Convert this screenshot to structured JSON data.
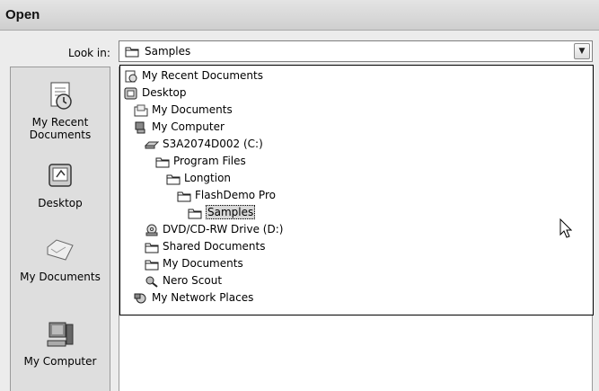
{
  "dialog": {
    "title": "Open"
  },
  "look_in": {
    "label": "Look in:",
    "value": "Samples",
    "dropdown_icon": "chevron-down-icon"
  },
  "places": [
    {
      "label": "My Recent Documents",
      "icon": "recent-documents-icon"
    },
    {
      "label": "Desktop",
      "icon": "desktop-icon"
    },
    {
      "label": "My Documents",
      "icon": "my-documents-icon"
    },
    {
      "label": "My Computer",
      "icon": "my-computer-icon"
    }
  ],
  "dropdown_items": [
    {
      "label": "My Recent Documents",
      "icon": "recent-documents-icon",
      "level": 0
    },
    {
      "label": "Desktop",
      "icon": "desktop-icon",
      "level": 0
    },
    {
      "label": "My Documents",
      "icon": "my-documents-icon",
      "level": 1
    },
    {
      "label": "My Computer",
      "icon": "my-computer-icon",
      "level": 1
    },
    {
      "label": "S3A2074D002 (C:)",
      "icon": "hard-drive-icon",
      "level": 2
    },
    {
      "label": "Program Files",
      "icon": "folder-icon",
      "level": 3
    },
    {
      "label": "Longtion",
      "icon": "folder-icon",
      "level": 4
    },
    {
      "label": "FlashDemo Pro",
      "icon": "folder-icon",
      "level": 5
    },
    {
      "label": "Samples",
      "icon": "folder-icon",
      "level": 6,
      "selected": true
    },
    {
      "label": "DVD/CD-RW Drive (D:)",
      "icon": "cd-drive-icon",
      "level": 2
    },
    {
      "label": "Shared Documents",
      "icon": "folder-icon",
      "level": 2
    },
    {
      "label": "My Documents",
      "icon": "folder-icon",
      "level": 2
    },
    {
      "label": "Nero Scout",
      "icon": "nero-scout-icon",
      "level": 2
    },
    {
      "label": "My Network Places",
      "icon": "network-places-icon",
      "level": 1
    }
  ]
}
